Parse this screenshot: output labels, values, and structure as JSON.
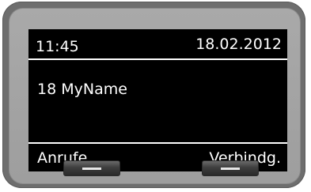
{
  "status_bar": {
    "time": "11:45",
    "date": "18.02.2012"
  },
  "main": {
    "caller": "18 MyName"
  },
  "softkeys": {
    "left_label": "Anrufe",
    "right_label": "Verbindg."
  },
  "colors": {
    "screen_background": "#000000",
    "screen_text": "#ffffff",
    "bezel": "#6e6e6e",
    "panel": "#a9a9a9"
  }
}
